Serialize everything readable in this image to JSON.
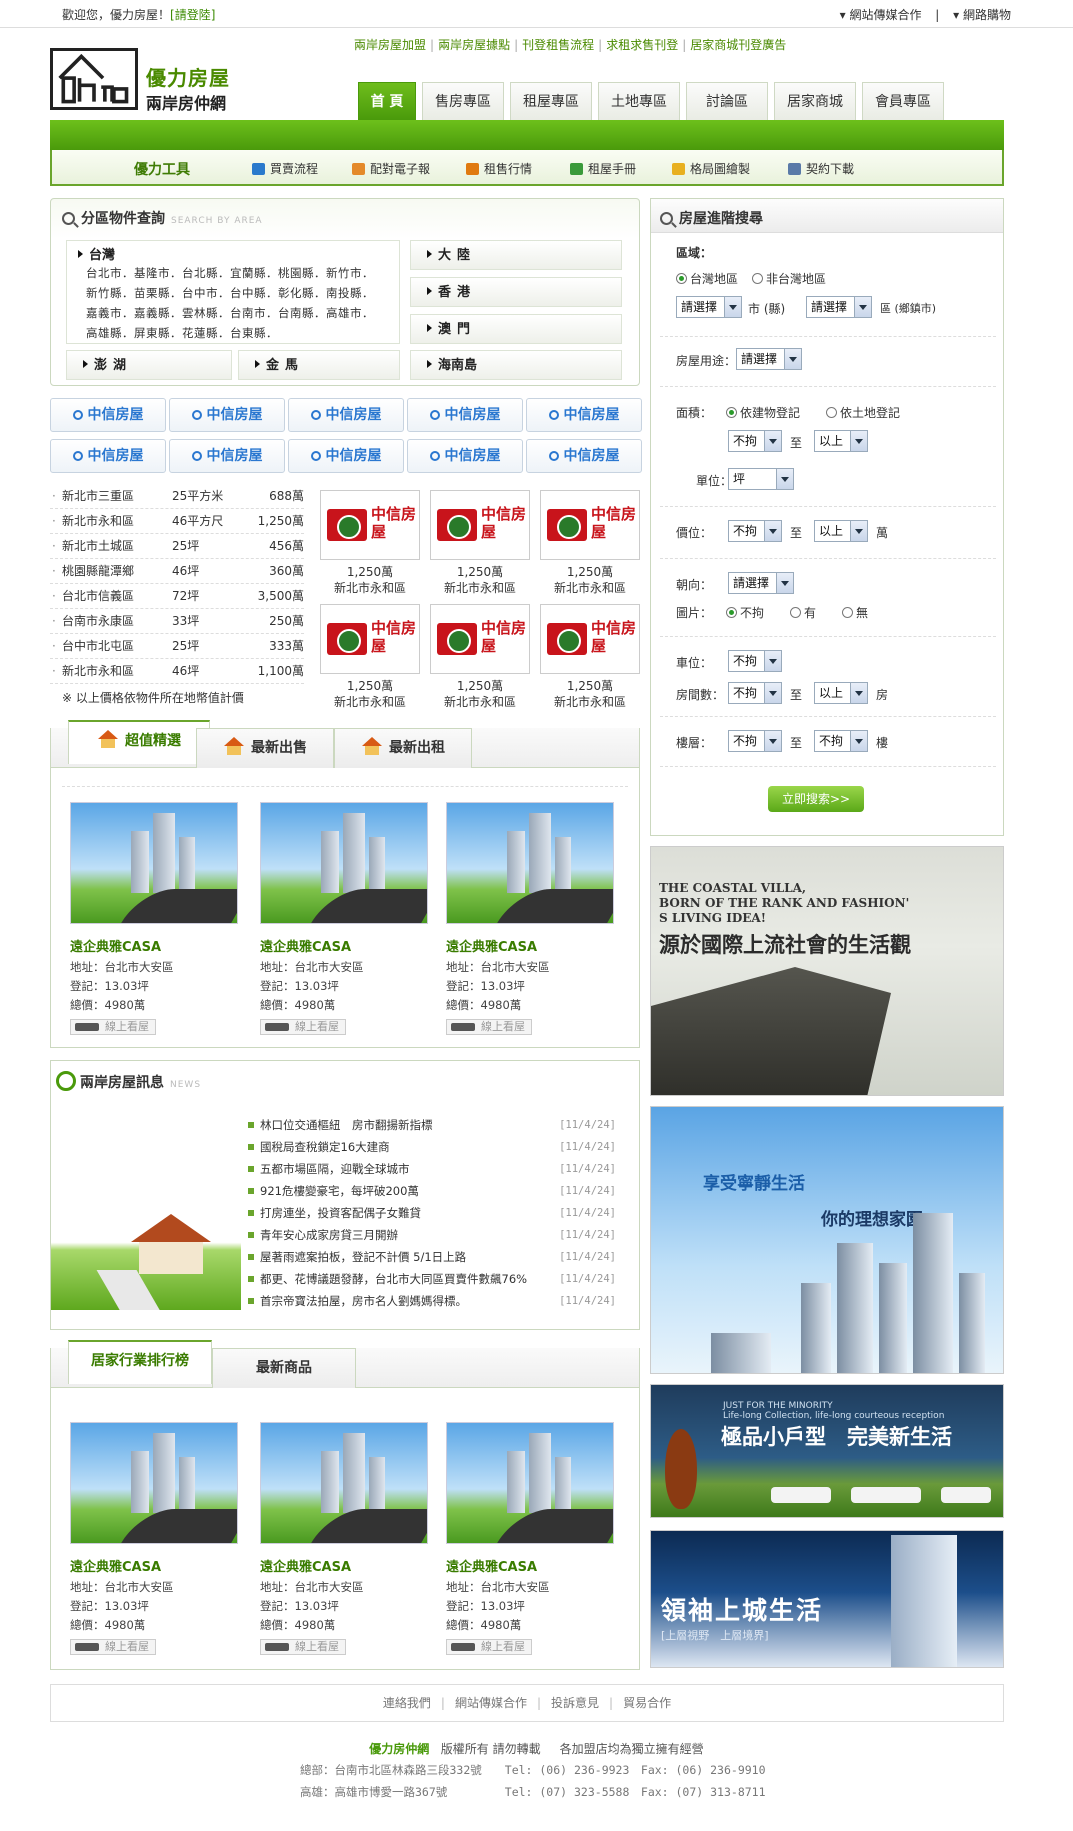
{
  "topbar": {
    "welcome": "歡迎您，優力房屋！",
    "login": "[請登陸]",
    "links": [
      "▾ 網站傳媒合作",
      "|",
      "▾ 網路購物"
    ]
  },
  "header": {
    "brand": "優力房屋",
    "subtitle": "兩岸房仲網",
    "promo_links": [
      "兩岸房屋加盟",
      "兩岸房屋據點",
      "刊登租售流程",
      "求租求售刊登",
      "居家商城刊登廣告"
    ]
  },
  "nav": [
    "首 頁",
    "售房專區",
    "租屋專區",
    "土地專區",
    "討論區",
    "居家商城",
    "會員專區"
  ],
  "toolbar": {
    "title": "優力工具",
    "tools": [
      "買賣流程",
      "配對電子報",
      "租售行情",
      "租屋手冊",
      "格局圖繪製",
      "契約下載"
    ],
    "tool_colors": [
      "#2a7acc",
      "#e48a2a",
      "#e07a10",
      "#3a9a3a",
      "#e8b020",
      "#5a7aa8"
    ]
  },
  "area_search": {
    "title": "分區物件查詢",
    "title_en": "SEARCH BY AREA",
    "taiwan_label": "台灣",
    "taiwan_lines": [
      "台北市．基隆市．台北縣．宜蘭縣．桃園縣．新竹市．",
      "新竹縣．苗栗縣．台中市．台中縣．彰化縣．南投縣．",
      "嘉義市．嘉義縣．雲林縣．台南市．台南縣．高雄市．",
      "高雄縣．屏東縣．花蓮縣．台東縣．"
    ],
    "regions_right": [
      "大陸",
      "香港",
      "澳門",
      "海南島"
    ],
    "regions_bottom": [
      "澎湖",
      "金馬"
    ]
  },
  "brand_buttons": [
    "中信房屋",
    "中信房屋",
    "中信房屋",
    "中信房屋",
    "中信房屋",
    "中信房屋",
    "中信房屋",
    "中信房屋",
    "中信房屋",
    "中信房屋"
  ],
  "listings": [
    {
      "area": "新北市三重區",
      "size": "25平方米",
      "price": "688萬"
    },
    {
      "area": "新北市永和區",
      "size": "46平方尺",
      "price": "1,250萬"
    },
    {
      "area": "新北市土城區",
      "size": "25坪",
      "price": "456萬"
    },
    {
      "area": "桃園縣龍潭鄉",
      "size": "46坪",
      "price": "360萬"
    },
    {
      "area": "台北市信義區",
      "size": "72坪",
      "price": "3,500萬"
    },
    {
      "area": "台南市永康區",
      "size": "33坪",
      "price": "250萬"
    },
    {
      "area": "台中市北屯區",
      "size": "25坪",
      "price": "333萬"
    },
    {
      "area": "新北市永和區",
      "size": "46坪",
      "price": "1,100萬"
    }
  ],
  "listing_note": "※ 以上價格依物件所在地幣值計價",
  "logo_cards": [
    {
      "logo": "中信房屋",
      "price": "1,250萬",
      "area": "新北市永和區"
    },
    {
      "logo": "中信房屋",
      "price": "1,250萬",
      "area": "新北市永和區"
    },
    {
      "logo": "中信房屋",
      "price": "1,250萬",
      "area": "新北市永和區"
    },
    {
      "logo": "中信房屋",
      "price": "1,250萬",
      "area": "新北市永和區"
    },
    {
      "logo": "中信房屋",
      "price": "1,250萬",
      "area": "新北市永和區"
    },
    {
      "logo": "中信房屋",
      "price": "1,250萬",
      "area": "新北市永和區"
    }
  ],
  "tabs1": [
    "超值精選",
    "最新出售",
    "最新出租"
  ],
  "props1": [
    {
      "name": "遠企典雅CASA",
      "addr": "地址：台北市大安區",
      "reg": "登記：13.03坪",
      "total": "總價：4980萬",
      "tour": "線上看屋"
    },
    {
      "name": "遠企典雅CASA",
      "addr": "地址：台北市大安區",
      "reg": "登記：13.03坪",
      "total": "總價：4980萬",
      "tour": "線上看屋"
    },
    {
      "name": "遠企典雅CASA",
      "addr": "地址：台北市大安區",
      "reg": "登記：13.03坪",
      "total": "總價：4980萬",
      "tour": "線上看屋"
    }
  ],
  "news": {
    "title": "兩岸房屋訊息",
    "title_en": "NEWS",
    "items": [
      {
        "t": "林口位交通樞紐　房市翻揚新指標",
        "d": "[11/4/24]"
      },
      {
        "t": "國稅局查稅鎖定16大建商",
        "d": "[11/4/24]"
      },
      {
        "t": "五都市場區隔，迎戰全球城市",
        "d": "[11/4/24]"
      },
      {
        "t": "921危樓變豪宅，每坪破200萬",
        "d": "[11/4/24]"
      },
      {
        "t": "打房連坐，投資客配偶子女難貸",
        "d": "[11/4/24]"
      },
      {
        "t": "青年安心成家房貸三月開辦",
        "d": "[11/4/24]"
      },
      {
        "t": "屋著雨遮案拍板，登記不計價 5/1日上路",
        "d": "[11/4/24]"
      },
      {
        "t": "都更、花博議題發酵，台北市大同區買賣件數飆76%",
        "d": "[11/4/24]"
      },
      {
        "t": "首宗帝寶法拍屋，房市名人劉媽媽得標。",
        "d": "[11/4/24]"
      }
    ]
  },
  "tabs2": [
    "居家行業排行榜",
    "最新商品"
  ],
  "props2": [
    {
      "name": "遠企典雅CASA",
      "addr": "地址：台北市大安區",
      "reg": "登記：13.03坪",
      "total": "總價：4980萬",
      "tour": "線上看屋"
    },
    {
      "name": "遠企典雅CASA",
      "addr": "地址：台北市大安區",
      "reg": "登記：13.03坪",
      "total": "總價：4980萬",
      "tour": "線上看屋"
    },
    {
      "name": "遠企典雅CASA",
      "addr": "地址：台北市大安區",
      "reg": "登記：13.03坪",
      "total": "總價：4980萬",
      "tour": "線上看屋"
    }
  ],
  "search": {
    "title": "房屋進階搜尋",
    "region_label": "區域：",
    "region_opts": [
      "台灣地區",
      "非台灣地區"
    ],
    "select_default": "請選擇",
    "city_unit": "市 (縣)",
    "district_unit": "區 (鄉鎮市)",
    "usage_label": "房屋用途：",
    "area_label": "面積：",
    "area_opts": [
      "依建物登記",
      "依土地登記"
    ],
    "any": "不拘",
    "above": "以上",
    "to": "至",
    "unit_label": "單位：",
    "unit_value": "坪",
    "price_label": "價位：",
    "price_unit": "萬",
    "facing_label": "朝向：",
    "photo_label": "圖片：",
    "photo_opts": [
      "不拘",
      "有",
      "無"
    ],
    "parking_label": "車位：",
    "rooms_label": "房間數：",
    "rooms_unit": "房",
    "floor_label": "樓層：",
    "floor_unit": "樓",
    "button": "立即搜索>>"
  },
  "ads": {
    "ad1_en": [
      "THE COASTAL VILLA,",
      "BORN OF THE RANK AND FASHION'",
      "S LIVING IDEA!"
    ],
    "ad1_cn": "源於國際上流社會的生活觀",
    "ad2_t1": "享受寧靜生活",
    "ad2_t2": "你的理想家園",
    "ad3_en": [
      "JUST FOR THE MINORITY",
      "Life-long Collection, life-long courteous reception"
    ],
    "ad3_cn": "極品小戶型　完美新生活",
    "ad4_cn": "領袖上城生活",
    "ad4_sub": "[上層視野　上層境界]"
  },
  "footer": {
    "links": [
      "連絡我們",
      "網站傳媒合作",
      "投訴意見",
      "貿易合作"
    ],
    "brand": "優力房仲網",
    "copyright": "版權所有 請勿轉載",
    "franchise": "各加盟店均為獨立擁有經營",
    "line1": "總部：台南市北區林森路三段332號　　Tel: (06) 236-9923　Fax: (06) 236-9910",
    "line2": "高雄：高雄市博愛一路367號　　　　　Tel: (07) 323-5588　Fax: (07) 313-8711"
  }
}
